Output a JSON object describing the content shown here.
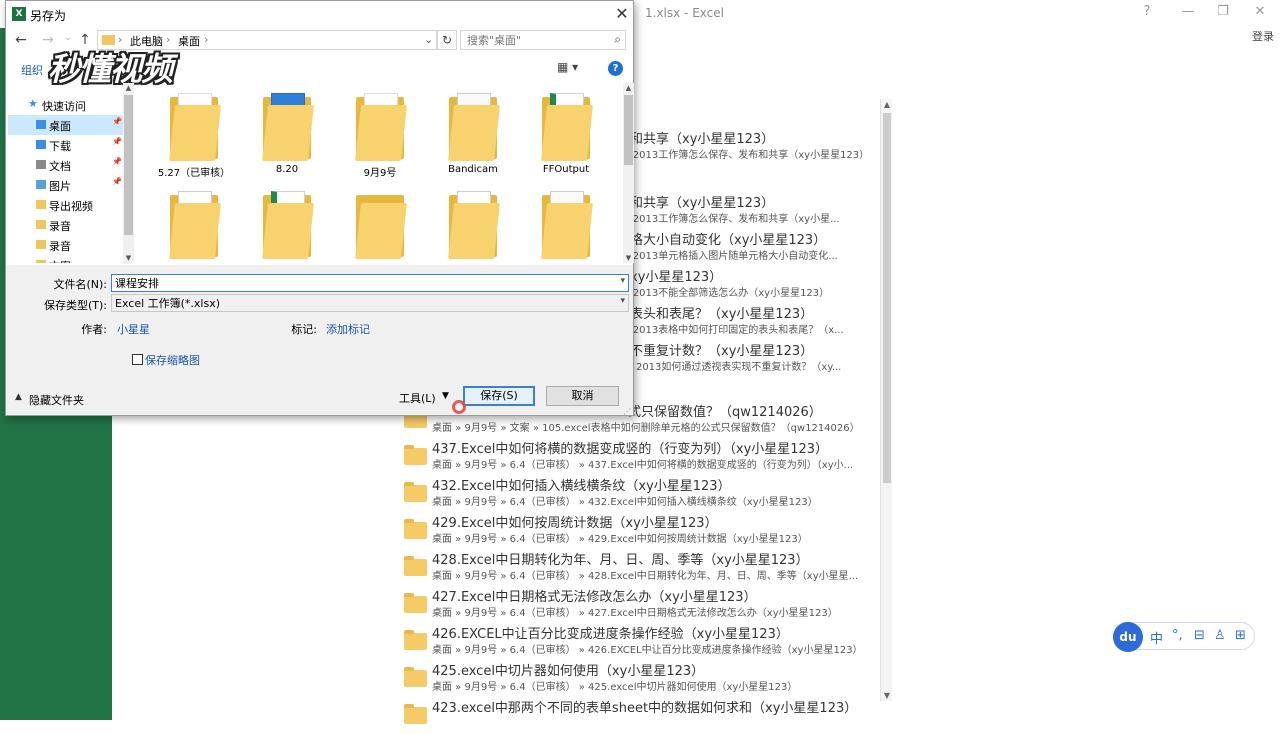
{
  "excel": {
    "title": "1.xlsx - Excel",
    "help": "?",
    "minimize": "—",
    "restore": "❐",
    "close": "✕",
    "signin": "登录",
    "recent": [
      {
        "title": "和共享（xy小星星123）",
        "path": "l2013工作簿怎么保存、发布和共享（xy小星星123）",
        "partial": true,
        "folder": false
      },
      {
        "title": "和共享（xy小星星123）",
        "path": "l2013工作簿怎么保存、发布和共享（xy小星...",
        "partial": true,
        "folder": false
      },
      {
        "title": "格大小自动变化（xy小星星123）",
        "path": "l2013单元格插入图片随单元格大小自动变化...",
        "partial": true,
        "folder": false
      },
      {
        "title": "xy小星星123）",
        "path": "l2013不能全部筛选怎么办（xy小星星123）",
        "partial": true,
        "folder": false
      },
      {
        "title": "表头和表尾？（xy小星星123）",
        "path": "l2013表格中如何打印固定的表头和表尾？（x...",
        "partial": true,
        "folder": false
      },
      {
        "title": "不重复计数？（xy小星星123）",
        "path": "l 2013如何通过透视表实现不重复计数？（xy...",
        "partial": true,
        "folder": false
      },
      {
        "title": "式只保留数值？（qw1214026）",
        "path": "桌面 » 9月9号 » 文案 » 105.excel表格中如何删除单元格的公式只保留数值？（qw1214026）",
        "partial": true,
        "folder": true
      },
      {
        "title": "437.Excel中如何将横的数据变成竖的（行变为列）（xy小星星123）",
        "path": "桌面 » 9月9号 » 6.4（已审核） » 437.Excel中如何将横的数据变成竖的（行变为列）（xy小...",
        "partial": false,
        "folder": true
      },
      {
        "title": "432.Excel中如何插入横线横条纹（xy小星星123）",
        "path": "桌面 » 9月9号 » 6.4（已审核） » 432.Excel中如何插入横线横条纹（xy小星星123）",
        "partial": false,
        "folder": true
      },
      {
        "title": "429.Excel中如何按周统计数据（xy小星星123）",
        "path": "桌面 » 9月9号 » 6.4（已审核） » 429.Excel中如何按周统计数据（xy小星星123）",
        "partial": false,
        "folder": true
      },
      {
        "title": "428.Excel中日期转化为年、月、日、周、季等（xy小星星123）",
        "path": "桌面 » 9月9号 » 6.4（已审核） » 428.Excel中日期转化为年、月、日、周、季等（xy小星星...",
        "partial": false,
        "folder": true
      },
      {
        "title": "427.Excel中日期格式无法修改怎么办（xy小星星123）",
        "path": "桌面 » 9月9号 » 6.4（已审核） » 427.Excel中日期格式无法修改怎么办（xy小星星123）",
        "partial": false,
        "folder": true
      },
      {
        "title": "426.EXCEL中让百分比变成进度条操作经验（xy小星星123）",
        "path": "桌面 » 9月9号 » 6.4（已审核） » 426.EXCEL中让百分比变成进度条操作经验（xy小星星123）",
        "partial": false,
        "folder": true
      },
      {
        "title": "425.excel中切片器如何使用（xy小星星123）",
        "path": "桌面 » 9月9号 » 6.4（已审核） » 425.excel中切片器如何使用（xy小星星123）",
        "partial": false,
        "folder": true
      },
      {
        "title": "423.excel中那两个不同的表单sheet中的数据如何求和（xy小星星123）",
        "path": "",
        "partial": false,
        "folder": true
      }
    ]
  },
  "ime": {
    "logo": "du",
    "keys": [
      "中",
      "°,",
      "⊟",
      "♙",
      "⊞"
    ]
  },
  "dialog": {
    "title": "另存为",
    "title_icon": "X",
    "close": "✕",
    "nav": {
      "back": "←",
      "forward": "→",
      "recent": "⌄",
      "up": "↑"
    },
    "address": {
      "crumbs": [
        "此电脑",
        "桌面"
      ],
      "sep": "›",
      "dropdown": "⌄",
      "refresh": "↻"
    },
    "search": {
      "placeholder": "搜索\"桌面\"",
      "icon": "⌕"
    },
    "organize": "组织",
    "watermark": "秒懂视频",
    "view": "▦ ▾",
    "help": "?",
    "nav_pane": [
      {
        "label": "快速访问",
        "icon": "star",
        "pinned": false,
        "selected": false
      },
      {
        "label": "桌面",
        "icon": "desktop",
        "pinned": true,
        "selected": true
      },
      {
        "label": "下载",
        "icon": "download",
        "pinned": true,
        "selected": false
      },
      {
        "label": "文档",
        "icon": "document",
        "pinned": true,
        "selected": false
      },
      {
        "label": "图片",
        "icon": "picture",
        "pinned": true,
        "selected": false
      },
      {
        "label": "导出视频",
        "icon": "folder",
        "pinned": false,
        "selected": false
      },
      {
        "label": "录音",
        "icon": "folder",
        "pinned": false,
        "selected": false
      },
      {
        "label": "录音",
        "icon": "folder",
        "pinned": false,
        "selected": false
      },
      {
        "label": "文案",
        "icon": "folder",
        "pinned": false,
        "selected": false
      }
    ],
    "files": [
      {
        "label": "5.27（已审核）",
        "doc": "plain"
      },
      {
        "label": "8.20",
        "doc": "blue"
      },
      {
        "label": "9月9号",
        "doc": "plain"
      },
      {
        "label": "Bandicam",
        "doc": "white"
      },
      {
        "label": "FFOutput",
        "doc": "green"
      },
      {
        "label": "",
        "doc": "chart"
      },
      {
        "label": "",
        "doc": "green"
      },
      {
        "label": "",
        "doc": "none"
      },
      {
        "label": "",
        "doc": "swirl"
      },
      {
        "label": "",
        "doc": "white"
      }
    ],
    "form": {
      "filename_label": "文件名(N):",
      "filename_value": "课程安排",
      "filetype_label": "保存类型(T):",
      "filetype_value": "Excel 工作簿(*.xlsx)",
      "author_label": "作者:",
      "author_value": "小星星",
      "tags_label": "标记:",
      "tags_value": "添加标记",
      "thumbnail_label": "保存缩略图",
      "hide_folders": "隐藏文件夹",
      "tools": "工具(L)",
      "save": "保存(S)",
      "cancel": "取消"
    }
  }
}
